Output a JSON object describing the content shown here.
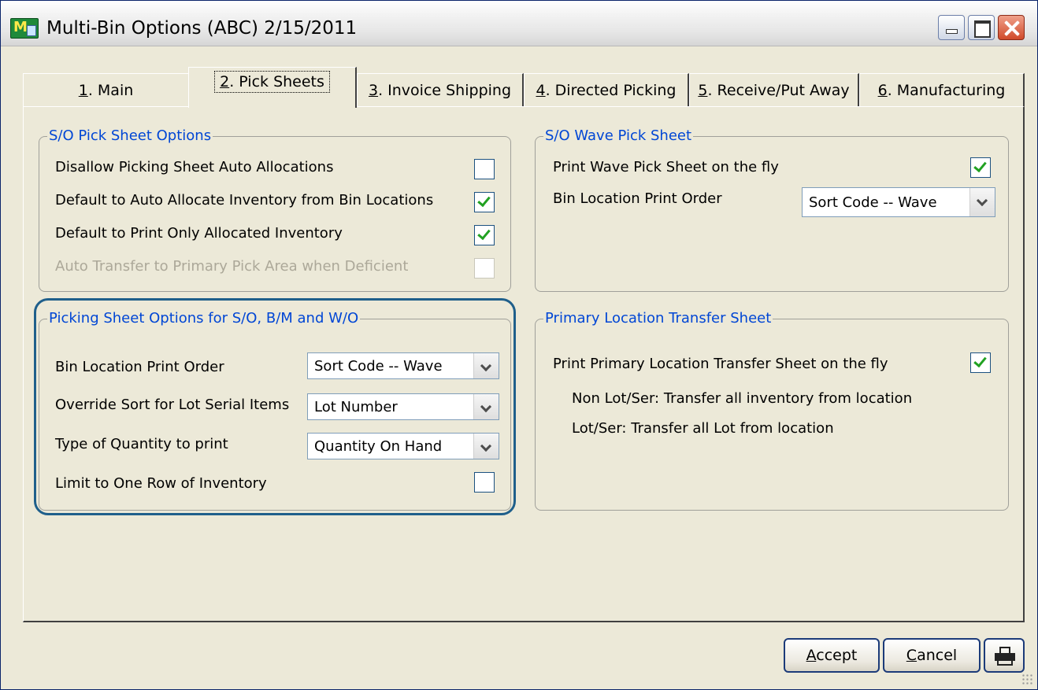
{
  "window": {
    "title": "Multi-Bin Options (ABC) 2/15/2011",
    "icon_text": "M"
  },
  "tabs": [
    {
      "num": "1",
      "rest": ". Main"
    },
    {
      "num": "2",
      "rest": ". Pick Sheets"
    },
    {
      "num": "3",
      "rest": ". Invoice Shipping"
    },
    {
      "num": "4",
      "rest": ". Directed Picking"
    },
    {
      "num": "5",
      "rest": ". Receive/Put Away"
    },
    {
      "num": "6",
      "rest": ". Manufacturing"
    }
  ],
  "active_tab": "2. Pick Sheets",
  "so_pick": {
    "title": "S/O Pick Sheet Options",
    "rows": [
      {
        "label": "Disallow Picking Sheet Auto Allocations",
        "checked": false,
        "enabled": true
      },
      {
        "label": "Default to Auto Allocate Inventory from Bin Locations",
        "checked": true,
        "enabled": true
      },
      {
        "label": "Default to Print Only Allocated Inventory",
        "checked": true,
        "enabled": true
      },
      {
        "label": "Auto Transfer to Primary Pick Area when Deficient",
        "checked": false,
        "enabled": false
      }
    ]
  },
  "picking_options": {
    "title": "Picking Sheet Options for S/O, B/M and W/O",
    "bin_order_label": "Bin Location Print Order",
    "bin_order_value": "Sort Code -- Wave",
    "override_label": "Override Sort for Lot Serial Items",
    "override_value": "Lot Number",
    "qty_label": "Type of Quantity to print",
    "qty_value": "Quantity On Hand",
    "limit_label": "Limit to One Row of Inventory",
    "limit_checked": false
  },
  "wave": {
    "title": "S/O Wave Pick Sheet",
    "print_label": "Print Wave Pick Sheet on the fly",
    "print_checked": true,
    "bin_order_label": "Bin Location Print Order",
    "bin_order_value": "Sort Code -- Wave"
  },
  "transfer": {
    "title": "Primary Location Transfer Sheet",
    "print_label": "Print Primary Location Transfer Sheet on the fly",
    "print_checked": true,
    "note1": "Non Lot/Ser: Transfer all inventory from location",
    "note2": "Lot/Ser: Transfer all Lot from location"
  },
  "buttons": {
    "accept_u": "A",
    "accept_rest": "ccept",
    "cancel_u": "C",
    "cancel_rest": "ancel",
    "print_icon": "printer-icon"
  },
  "colors": {
    "group_title": "#0046d5",
    "highlight": "#1f5f8b",
    "check": "#21a121"
  }
}
